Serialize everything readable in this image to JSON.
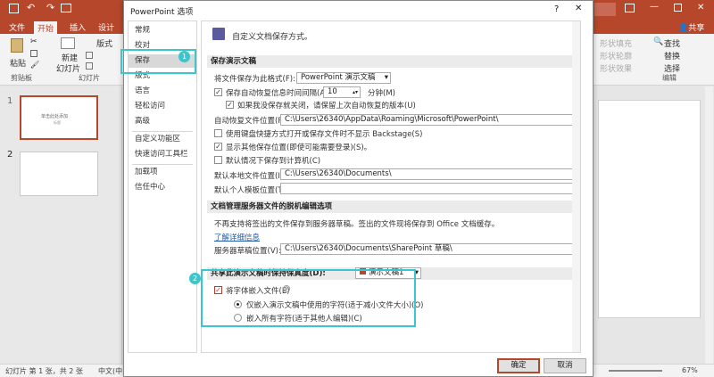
{
  "ppt": {
    "tabs": [
      "文件",
      "开始",
      "插入",
      "设计"
    ],
    "share_label": "共享",
    "ribbon": {
      "paste": "粘贴",
      "new_slide": "新建",
      "new_slide2": "幻灯片",
      "layout": "版式",
      "clipboard_group": "剪贴板",
      "slides_group": "幻灯片",
      "shape_fill": "形状填充",
      "shape_outline": "形状轮廓",
      "shape_effects": "形状效果",
      "find": "查找",
      "replace": "替换",
      "select": "选择",
      "edit_group": "编辑"
    },
    "slides": [
      {
        "num": "1",
        "title_text": "单击此处添加",
        "sub_text": "标题"
      },
      {
        "num": "2"
      }
    ],
    "status": {
      "slide_info": "幻灯片 第 1 张，共 2 张",
      "lang": "中文(中",
      "zoom": "67%"
    }
  },
  "dialog": {
    "title": "PowerPoint 选项",
    "help": "?",
    "close": "✕",
    "nav": [
      "常规",
      "校对",
      "保存",
      "版式",
      "语言",
      "轻松访问",
      "高级",
      "自定义功能区",
      "快速访问工具栏",
      "加载项",
      "信任中心"
    ],
    "header": "自定义文档保存方式。",
    "sec_save": "保存演示文稿",
    "format_label": "将文件保存为此格式(F):",
    "format_value": "PowerPoint 演示文稿",
    "autosave_label": "保存自动恢复信息时间间隔(A)",
    "autosave_value": "10",
    "autosave_unit": "分钟(M)",
    "keep_last_label": "如果我没保存就关闭，请保留上次自动恢复的版本(U)",
    "autorecover_loc_label": "自动恢复文件位置(R):",
    "autorecover_loc": "C:\\Users\\26340\\AppData\\Roaming\\Microsoft\\PowerPoint\\",
    "backstage_label": "使用键盘快捷方式打开或保存文件时不显示 Backstage(S)",
    "show_more_label": "显示其他保存位置(即使可能需要登录)(S)。",
    "default_pc_label": "默认情况下保存到计算机(C)",
    "default_local_label": "默认本地文件位置(I):",
    "default_local": "C:\\Users\\26340\\Documents\\",
    "default_template_label": "默认个人模板位置(T):",
    "default_template": "",
    "sec_server": "文档管理服务器文件的脱机编辑选项",
    "server_note": "不再支持将签出的文件保存到服务器草稿。签出的文件现将保存到 Office 文档缓存。",
    "learn_more": "了解详细信息",
    "server_drafts_label": "服务器草稿位置(V):",
    "server_drafts": "C:\\Users\\26340\\Documents\\SharePoint 草稿\\",
    "sec_fidelity": "共享此演示文稿时保持保真度(D):",
    "fidelity_value": "演示文稿1",
    "embed_fonts_label": "将字体嵌入文件(E)",
    "embed_used_label": "仅嵌入演示文稿中使用的字符(适于减小文件大小)(O)",
    "embed_all_label": "嵌入所有字符(适于其他人编辑)(C)",
    "ok": "确定",
    "cancel": "取消"
  },
  "annotations": {
    "badge1": "1",
    "badge2": "2",
    "color": "#3cc5cd"
  }
}
